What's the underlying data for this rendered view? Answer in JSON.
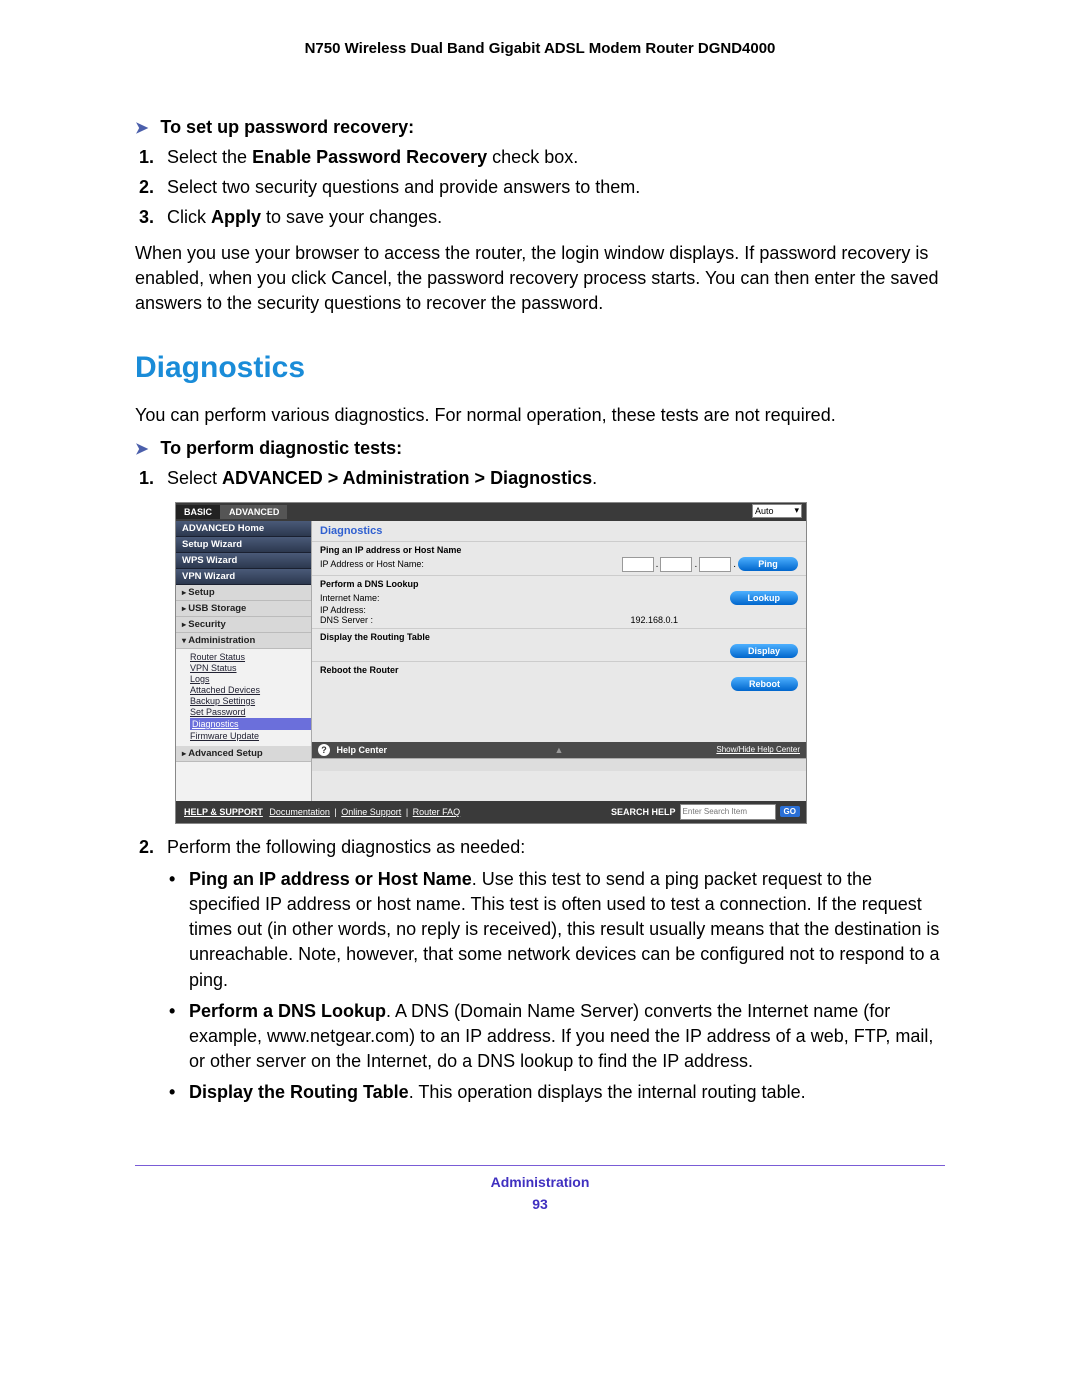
{
  "header": {
    "title": "N750 Wireless Dual Band Gigabit ADSL Modem Router DGND4000"
  },
  "pwrecovery": {
    "heading": "To set up password recovery:",
    "steps": [
      {
        "pre": "Select the ",
        "bold": "Enable Password Recovery",
        "post": " check box."
      },
      {
        "pre": "Select two security questions and provide answers to them.",
        "bold": "",
        "post": ""
      },
      {
        "pre": "Click ",
        "bold": "Apply",
        "post": " to save your changes."
      }
    ],
    "paragraph": "When you use your browser to access the router, the login window displays. If password recovery is enabled, when you click Cancel, the password recovery process starts. You can then enter the saved answers to the security questions to recover the password."
  },
  "diag": {
    "title": "Diagnostics",
    "intro": "You can perform various diagnostics. For normal operation, these tests are not required.",
    "heading": "To perform diagnostic tests:",
    "step1_pre": "Select ",
    "step1_bold": "ADVANCED > Administration > Diagnostics",
    "step1_post": ".",
    "step2": "Perform the following diagnostics as needed:",
    "bullets": [
      {
        "bold": "Ping an IP address or Host Name",
        "text": ". Use this test to send a ping packet request to the specified IP address or host name. This test is often used to test a connection. If the request times out (in other words, no reply is received), this result usually means that the destination is unreachable. Note, however, that some network devices can be configured not to respond to a ping."
      },
      {
        "bold": "Perform a DNS Lookup",
        "text": ". A DNS (Domain Name Server) converts the Internet name (for example, www.netgear.com) to an IP address. If you need the IP address of a web, FTP, mail, or other server on the Internet, do a DNS lookup to find the IP address."
      },
      {
        "bold": " Display the Routing Table",
        "text": ". This operation displays the internal routing table."
      }
    ]
  },
  "screenshot": {
    "tabs": {
      "basic": "BASIC",
      "advanced": "ADVANCED",
      "auto": "Auto"
    },
    "sidebar": {
      "advanced_home": "ADVANCED Home",
      "setup_wizard": "Setup Wizard",
      "wps_wizard": "WPS Wizard",
      "vpn_wizard": "VPN Wizard",
      "setup": "Setup",
      "usb_storage": "USB Storage",
      "security": "Security",
      "administration": "Administration",
      "sub": {
        "router_status": "Router Status",
        "vpn_status": "VPN Status",
        "logs": "Logs",
        "attached_devices": "Attached Devices",
        "backup_settings": "Backup Settings",
        "set_password": "Set Password",
        "diagnostics": "Diagnostics",
        "firmware_update": "Firmware Update"
      },
      "advanced_setup": "Advanced Setup"
    },
    "panel": {
      "title": "Diagnostics",
      "ping_title": "Ping an IP address or Host Name",
      "ping_label": "IP Address or Host Name:",
      "ping_btn": "Ping",
      "dns_title": "Perform a DNS Lookup",
      "dns_label": "Internet Name:",
      "lookup_btn": "Lookup",
      "ip_address_label": "IP Address:",
      "dns_server_label": "DNS Server :",
      "dns_server_value": "192.168.0.1",
      "routing_title": "Display the Routing Table",
      "display_btn": "Display",
      "reboot_title": "Reboot the Router",
      "reboot_btn": "Reboot",
      "help_center": "Help Center",
      "show_hide": "Show/Hide Help Center"
    },
    "footer": {
      "help_support": "HELP & SUPPORT",
      "documentation": "Documentation",
      "online_support": "Online Support",
      "router_faq": "Router FAQ",
      "search_help": "SEARCH HELP",
      "search_placeholder": "Enter Search Item",
      "go": "GO"
    }
  },
  "footer": {
    "section": "Administration",
    "page": "93"
  }
}
